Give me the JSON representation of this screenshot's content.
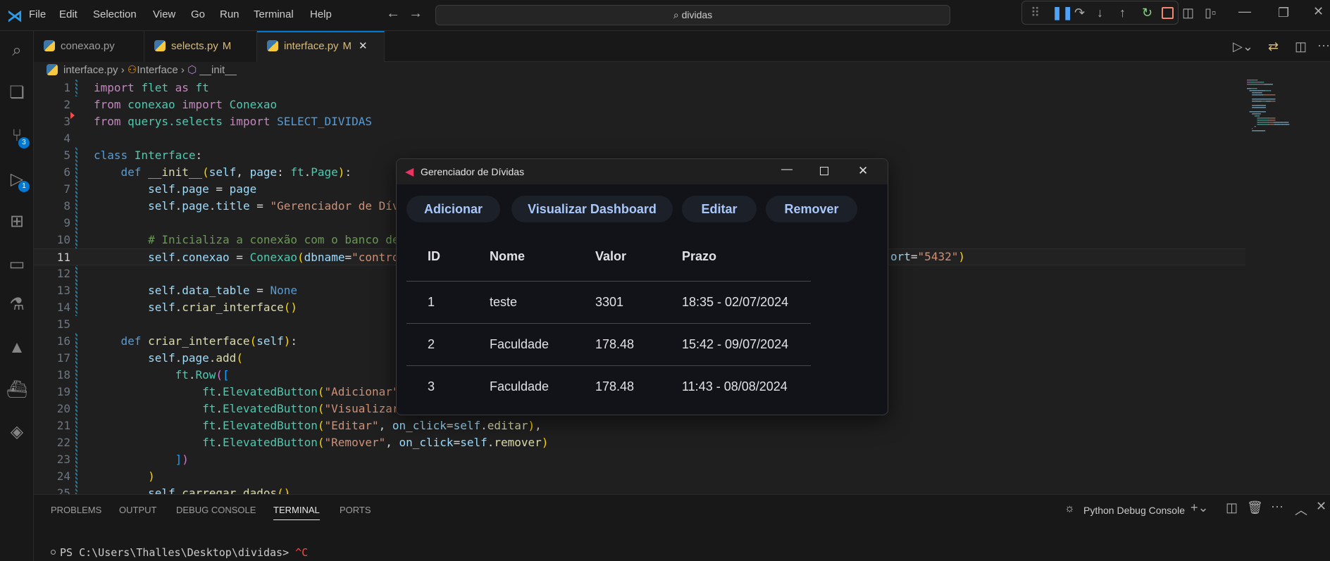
{
  "menu": [
    "File",
    "Edit",
    "Selection",
    "View",
    "Go",
    "Run",
    "Terminal",
    "Help"
  ],
  "search": "dividas",
  "activity": {
    "scm_badge": "3",
    "debug_badge": "1"
  },
  "tabs": [
    {
      "label": "conexao.py",
      "mod": ""
    },
    {
      "label": "selects.py",
      "mod": "M"
    },
    {
      "label": "interface.py",
      "mod": "M"
    }
  ],
  "breadcrumb": [
    "interface.py",
    "Interface",
    "__init__"
  ],
  "code": [
    [
      [
        "kw",
        "import "
      ],
      [
        "md",
        "flet "
      ],
      [
        "kw",
        "as "
      ],
      [
        "md",
        "ft"
      ]
    ],
    [
      [
        "kw",
        "from "
      ],
      [
        "md",
        "conexao "
      ],
      [
        "kw",
        "import "
      ],
      [
        "md",
        "Conexao"
      ]
    ],
    [
      [
        "kw",
        "from "
      ],
      [
        "md",
        "querys.selects "
      ],
      [
        "kw",
        "import "
      ],
      [
        "bl",
        "SELECT_DIVIDAS"
      ]
    ],
    [],
    [
      [
        "bl",
        "class "
      ],
      [
        "md",
        "Interface"
      ],
      [
        "pl",
        ":"
      ]
    ],
    [
      [
        "pl",
        "    "
      ],
      [
        "bl",
        "def "
      ],
      [
        "fn",
        "__init__"
      ],
      [
        "br",
        "("
      ],
      [
        "vr",
        "self"
      ],
      [
        "pl",
        ", "
      ],
      [
        "vr",
        "page"
      ],
      [
        "pl",
        ": "
      ],
      [
        "md",
        "ft"
      ],
      [
        "pl",
        "."
      ],
      [
        "md",
        "Page"
      ],
      [
        "br",
        ")"
      ],
      [
        "pl",
        ":"
      ]
    ],
    [
      [
        "pl",
        "        "
      ],
      [
        "vr",
        "self"
      ],
      [
        "pl",
        "."
      ],
      [
        "vr",
        "page"
      ],
      [
        "pl",
        " = "
      ],
      [
        "vr",
        "page"
      ]
    ],
    [
      [
        "pl",
        "        "
      ],
      [
        "vr",
        "self"
      ],
      [
        "pl",
        "."
      ],
      [
        "vr",
        "page"
      ],
      [
        "pl",
        "."
      ],
      [
        "vr",
        "title"
      ],
      [
        "pl",
        " = "
      ],
      [
        "st",
        "\"Gerenciador de Dív"
      ]
    ],
    [],
    [
      [
        "pl",
        "        "
      ],
      [
        "cm",
        "# Inicializa a conexão com o banco de"
      ]
    ],
    [
      [
        "pl",
        "        "
      ],
      [
        "vr",
        "self"
      ],
      [
        "pl",
        "."
      ],
      [
        "vr",
        "conexao"
      ],
      [
        "pl",
        " = "
      ],
      [
        "md",
        "Conexao"
      ],
      [
        "br",
        "("
      ],
      [
        "vr",
        "dbname"
      ],
      [
        "pl",
        "="
      ],
      [
        "st",
        "\"contro"
      ]
    ],
    [],
    [
      [
        "pl",
        "        "
      ],
      [
        "vr",
        "self"
      ],
      [
        "pl",
        "."
      ],
      [
        "vr",
        "data_table"
      ],
      [
        "pl",
        " = "
      ],
      [
        "bl",
        "None"
      ]
    ],
    [
      [
        "pl",
        "        "
      ],
      [
        "vr",
        "self"
      ],
      [
        "pl",
        "."
      ],
      [
        "fn",
        "criar_interface"
      ],
      [
        "br",
        "()"
      ]
    ],
    [],
    [
      [
        "pl",
        "    "
      ],
      [
        "bl",
        "def "
      ],
      [
        "fn",
        "criar_interface"
      ],
      [
        "br",
        "("
      ],
      [
        "vr",
        "self"
      ],
      [
        "br",
        ")"
      ],
      [
        "pl",
        ":"
      ]
    ],
    [
      [
        "pl",
        "        "
      ],
      [
        "vr",
        "self"
      ],
      [
        "pl",
        "."
      ],
      [
        "vr",
        "page"
      ],
      [
        "pl",
        "."
      ],
      [
        "fn",
        "add"
      ],
      [
        "br",
        "("
      ]
    ],
    [
      [
        "pl",
        "            "
      ],
      [
        "md",
        "ft"
      ],
      [
        "pl",
        "."
      ],
      [
        "md",
        "Row"
      ],
      [
        "br2",
        "("
      ],
      [
        "br3",
        "["
      ]
    ],
    [
      [
        "pl",
        "                "
      ],
      [
        "md",
        "ft"
      ],
      [
        "pl",
        "."
      ],
      [
        "md",
        "ElevatedButton"
      ],
      [
        "br",
        "("
      ],
      [
        "st",
        "\"Adicionar\""
      ]
    ],
    [
      [
        "pl",
        "                "
      ],
      [
        "md",
        "ft"
      ],
      [
        "pl",
        "."
      ],
      [
        "md",
        "ElevatedButton"
      ],
      [
        "br",
        "("
      ],
      [
        "st",
        "\"Visualizar"
      ]
    ],
    [
      [
        "pl",
        "                "
      ],
      [
        "md",
        "ft"
      ],
      [
        "pl",
        "."
      ],
      [
        "md",
        "ElevatedButton"
      ],
      [
        "br",
        "("
      ],
      [
        "st",
        "\"Editar\""
      ],
      [
        "pl",
        ", "
      ],
      [
        "vr",
        "on_click"
      ],
      [
        "pl",
        "="
      ],
      [
        "vr",
        "self"
      ],
      [
        "pl",
        "."
      ],
      [
        "fn",
        "editar"
      ],
      [
        "br",
        ")"
      ],
      [
        "pl",
        ","
      ]
    ],
    [
      [
        "pl",
        "                "
      ],
      [
        "md",
        "ft"
      ],
      [
        "pl",
        "."
      ],
      [
        "md",
        "ElevatedButton"
      ],
      [
        "br",
        "("
      ],
      [
        "st",
        "\"Remover\""
      ],
      [
        "pl",
        ", "
      ],
      [
        "vr",
        "on_click"
      ],
      [
        "pl",
        "="
      ],
      [
        "vr",
        "self"
      ],
      [
        "pl",
        "."
      ],
      [
        "fn",
        "remover"
      ],
      [
        "br",
        ")"
      ]
    ],
    [
      [
        "pl",
        "            "
      ],
      [
        "br3",
        "]"
      ],
      [
        "br2",
        ")"
      ]
    ],
    [
      [
        "pl",
        "        "
      ],
      [
        "br",
        ")"
      ]
    ],
    [
      [
        "pl",
        "        "
      ],
      [
        "vr",
        "self"
      ],
      [
        "pl",
        "."
      ],
      [
        "fn",
        "carregar_dados"
      ],
      [
        "br",
        "()"
      ]
    ]
  ],
  "line11_tail": [
    [
      "vr",
      "ort"
    ],
    [
      "pl",
      "="
    ],
    [
      "st",
      "\"5432\""
    ],
    [
      "br",
      ")"
    ]
  ],
  "current_line": 11,
  "panel": {
    "tabs": [
      "PROBLEMS",
      "OUTPUT",
      "DEBUG CONSOLE",
      "TERMINAL",
      "PORTS"
    ],
    "active": "TERMINAL",
    "terminal_name": "Python Debug Console",
    "prompt": "PS C:\\Users\\Thalles\\Desktop\\dividas> ",
    "input": "^C"
  },
  "dialog": {
    "title": "Gerenciador de Dívidas",
    "buttons": [
      "Adicionar",
      "Visualizar Dashboard",
      "Editar",
      "Remover"
    ],
    "columns": [
      "ID",
      "Nome",
      "Valor",
      "Prazo"
    ],
    "rows": [
      [
        "1",
        "teste",
        "3301",
        "18:35 - 02/07/2024"
      ],
      [
        "2",
        "Faculdade",
        "178.48",
        "15:42 - 09/07/2024"
      ],
      [
        "3",
        "Faculdade",
        "178.48",
        "11:43 - 08/08/2024"
      ]
    ]
  },
  "colors": {
    "accent": "#0078d4",
    "button_text": "#a8c7fa",
    "restart": "#89d185",
    "stop": "#f48771"
  }
}
